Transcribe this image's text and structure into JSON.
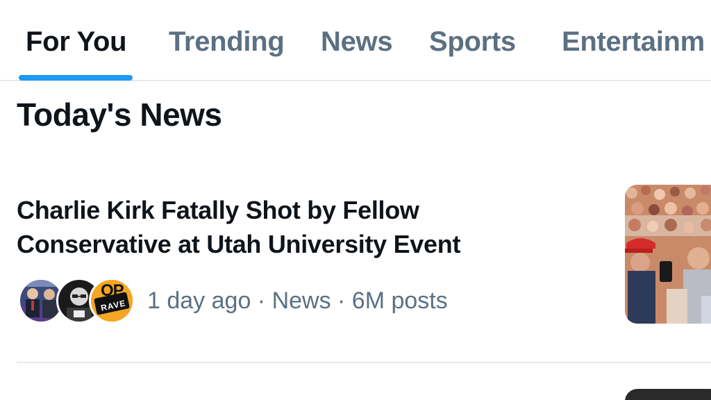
{
  "tabs": [
    {
      "label": "For You",
      "active": true
    },
    {
      "label": "Trending",
      "active": false
    },
    {
      "label": "News",
      "active": false
    },
    {
      "label": "Sports",
      "active": false
    },
    {
      "label": "Entertainm",
      "active": false
    }
  ],
  "section": {
    "title": "Today's News"
  },
  "news_items": [
    {
      "headline": "Charlie Kirk Fatally Shot by Fellow Conservative at Utah University Event",
      "meta": "1 day ago · News · 6M posts",
      "avatar_badge_text_top": "OP",
      "avatar_badge_text_bottom": "RAVE"
    }
  ],
  "colors": {
    "accent": "#1d9bf0",
    "text_primary": "#0f1419",
    "text_secondary": "#5b7083",
    "divider": "#e6e9ec",
    "badge_orange": "#f5a623"
  }
}
